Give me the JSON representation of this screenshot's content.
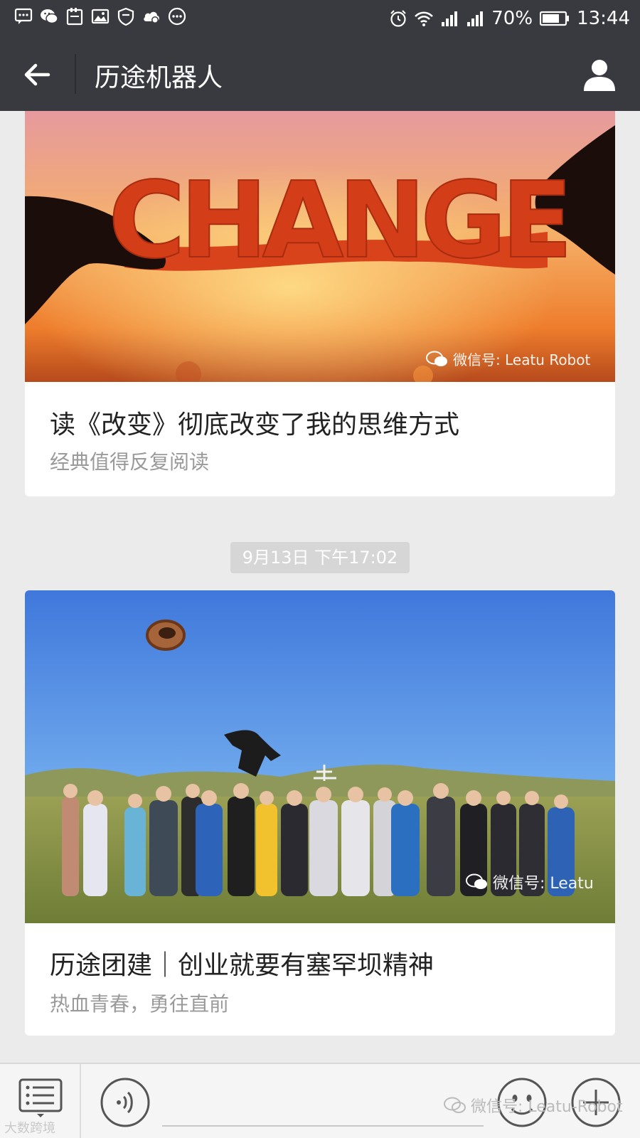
{
  "status_bar": {
    "battery": "70%",
    "time": "13:44",
    "left_icons": [
      "sms-icon",
      "wechat-icon",
      "clipboard-icon",
      "image-icon",
      "shield-icon",
      "cloud-icon",
      "more-icon"
    ],
    "right_icons": [
      "alarm-icon",
      "wifi-icon",
      "signal-icon",
      "signal-icon",
      "battery-icon"
    ]
  },
  "header": {
    "title": "历途机器人",
    "back_icon": "arrow-left-icon",
    "profile_icon": "person-icon"
  },
  "articles": [
    {
      "title": "读《改变》彻底改变了我的思维方式",
      "subtitle": "经典值得反复阅读",
      "image_text": "CHANGE",
      "watermark": "微信号: Leatu Robot"
    },
    {
      "title": "历途团建｜创业就要有塞罕坝精神",
      "subtitle": "热血青春，勇往直前",
      "watermark": "微信号: Leatu"
    }
  ],
  "timestamp": "9月13日 下午17:02",
  "bottom_bar": {
    "menu_icon": "menu-list-icon",
    "voice_icon": "voice-icon",
    "emoji_icon": "emoji-icon",
    "plus_icon": "plus-icon",
    "watermark": "微信号: Leatu-Robot",
    "corner_logo": "大数跨境"
  },
  "colors": {
    "bar_bg": "#393a3f",
    "page_bg": "#ebebeb",
    "card_bg": "#ffffff",
    "subtitle": "#9a9a9a"
  }
}
